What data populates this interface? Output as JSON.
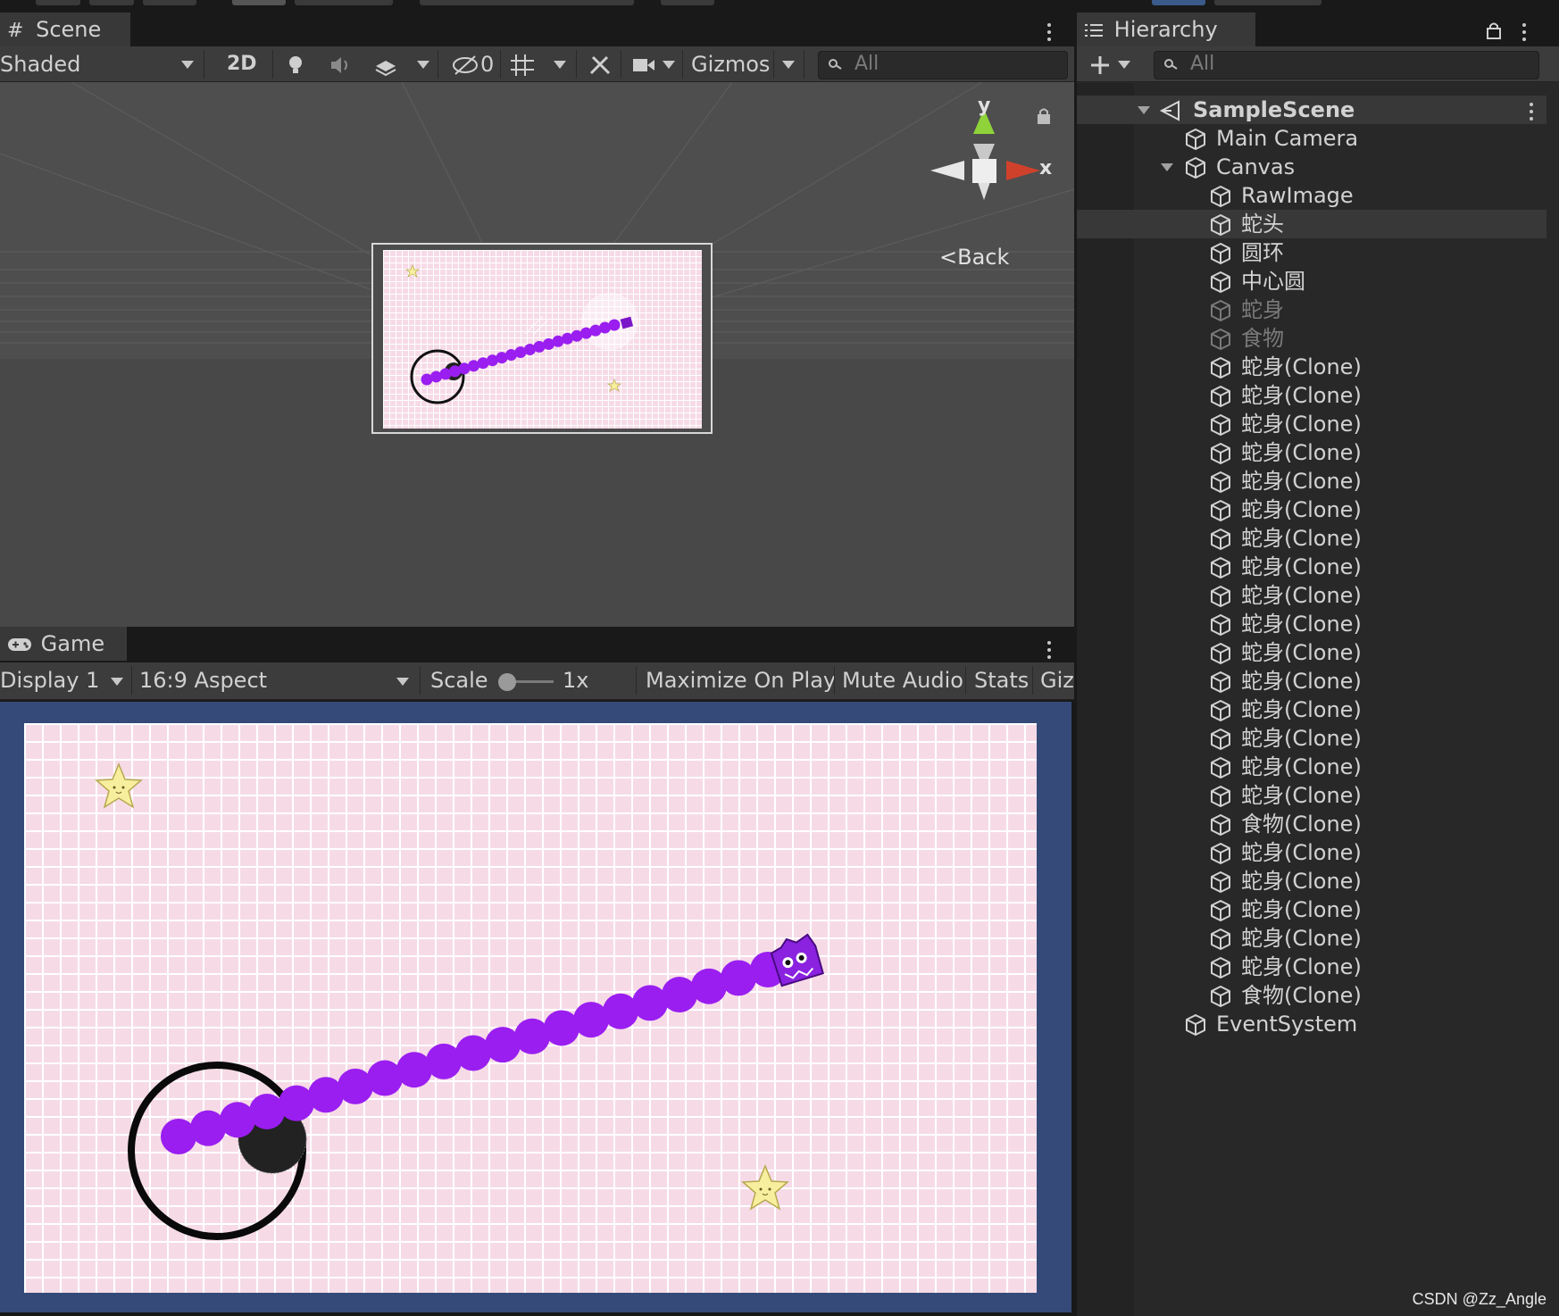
{
  "scene_panel": {
    "tab_label": "Scene",
    "shading_mode": "Shaded",
    "mode_2d": "2D",
    "hidden_count": "0",
    "gizmos_label": "Gizmos",
    "search_placeholder": "All",
    "gizmo_axis_y": "y",
    "gizmo_axis_x": "x",
    "view_label": "Back"
  },
  "game_panel": {
    "tab_label": "Game",
    "display": "Display 1",
    "aspect": "16:9 Aspect",
    "scale_label": "Scale",
    "scale_value": "1x",
    "maximize": "Maximize On Play",
    "mute": "Mute Audio",
    "stats": "Stats",
    "gizmos_clipped": "Giz"
  },
  "hierarchy": {
    "tab_label": "Hierarchy",
    "search_placeholder": "All",
    "scene_name": "SampleScene",
    "items": [
      {
        "label": "Main Camera",
        "level": 1,
        "dim": false
      },
      {
        "label": "Canvas",
        "level": 1,
        "dim": false,
        "expanded": true
      },
      {
        "label": "RawImage",
        "level": 2,
        "dim": false
      },
      {
        "label": "蛇头",
        "level": 2,
        "dim": false,
        "selected": true
      },
      {
        "label": "圆环",
        "level": 2,
        "dim": false
      },
      {
        "label": "中心圆",
        "level": 2,
        "dim": false
      },
      {
        "label": "蛇身",
        "level": 2,
        "dim": true
      },
      {
        "label": "食物",
        "level": 2,
        "dim": true
      },
      {
        "label": "蛇身(Clone)",
        "level": 2,
        "dim": false
      },
      {
        "label": "蛇身(Clone)",
        "level": 2,
        "dim": false
      },
      {
        "label": "蛇身(Clone)",
        "level": 2,
        "dim": false
      },
      {
        "label": "蛇身(Clone)",
        "level": 2,
        "dim": false
      },
      {
        "label": "蛇身(Clone)",
        "level": 2,
        "dim": false
      },
      {
        "label": "蛇身(Clone)",
        "level": 2,
        "dim": false
      },
      {
        "label": "蛇身(Clone)",
        "level": 2,
        "dim": false
      },
      {
        "label": "蛇身(Clone)",
        "level": 2,
        "dim": false
      },
      {
        "label": "蛇身(Clone)",
        "level": 2,
        "dim": false
      },
      {
        "label": "蛇身(Clone)",
        "level": 2,
        "dim": false
      },
      {
        "label": "蛇身(Clone)",
        "level": 2,
        "dim": false
      },
      {
        "label": "蛇身(Clone)",
        "level": 2,
        "dim": false
      },
      {
        "label": "蛇身(Clone)",
        "level": 2,
        "dim": false
      },
      {
        "label": "蛇身(Clone)",
        "level": 2,
        "dim": false
      },
      {
        "label": "蛇身(Clone)",
        "level": 2,
        "dim": false
      },
      {
        "label": "蛇身(Clone)",
        "level": 2,
        "dim": false
      },
      {
        "label": "食物(Clone)",
        "level": 2,
        "dim": false
      },
      {
        "label": "蛇身(Clone)",
        "level": 2,
        "dim": false
      },
      {
        "label": "蛇身(Clone)",
        "level": 2,
        "dim": false
      },
      {
        "label": "蛇身(Clone)",
        "level": 2,
        "dim": false
      },
      {
        "label": "蛇身(Clone)",
        "level": 2,
        "dim": false
      },
      {
        "label": "蛇身(Clone)",
        "level": 2,
        "dim": false
      },
      {
        "label": "食物(Clone)",
        "level": 2,
        "dim": false
      },
      {
        "label": "EventSystem",
        "level": 1,
        "dim": false
      }
    ]
  },
  "watermark": "CSDN @Zz_Angle",
  "colors": {
    "snake": "#9a1ef0",
    "game_background_frame": "#354a78",
    "board_pink": "#f6dbe7",
    "star": "#f7ef9e"
  }
}
